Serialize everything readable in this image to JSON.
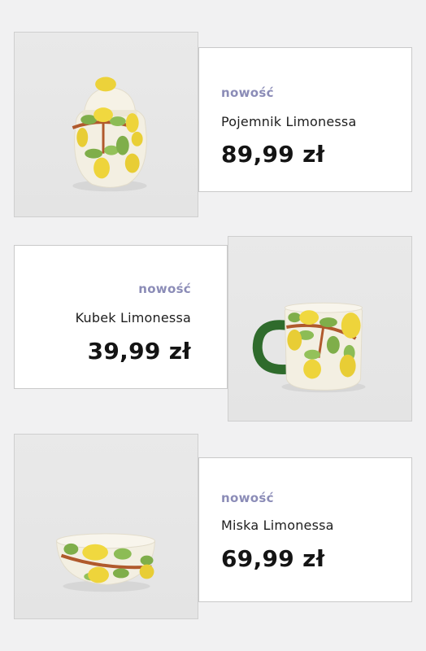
{
  "products": [
    {
      "badge": "nowość",
      "name": "Pojemnik Limonessa",
      "price": "89,99 zł",
      "image_icon": "lidded-jar-image"
    },
    {
      "badge": "nowość",
      "name": "Kubek Limonessa",
      "price": "39,99 zł",
      "image_icon": "mug-image"
    },
    {
      "badge": "nowość",
      "name": "Miska Limonessa",
      "price": "69,99 zł",
      "image_icon": "bowl-image"
    }
  ],
  "colors": {
    "badge": "#8b8cb7",
    "background": "#f1f1f2",
    "lemon": "#ecd23a",
    "leaf": "#7fae4a",
    "branch": "#b0592c",
    "mug_handle": "#2f6b2c"
  }
}
